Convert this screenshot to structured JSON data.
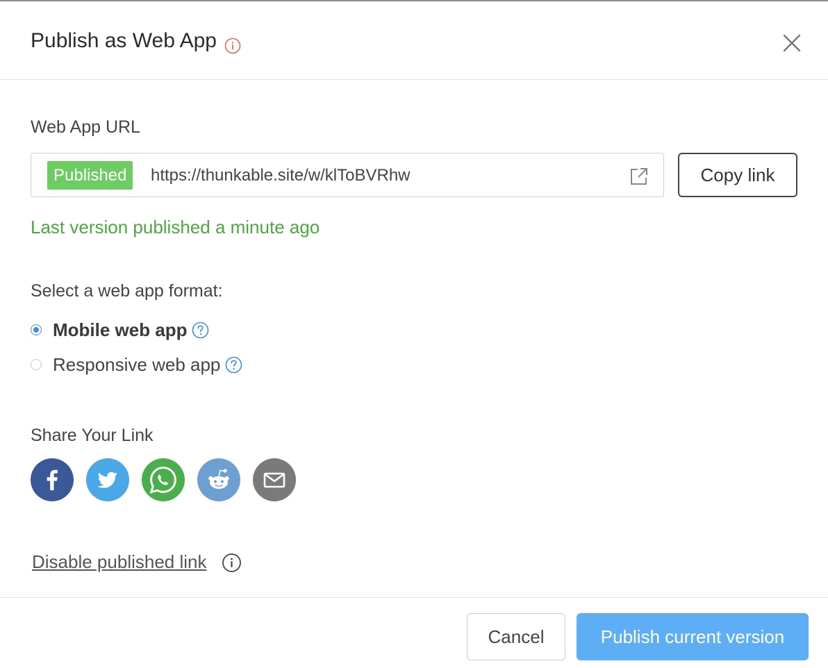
{
  "dialog": {
    "title": "Publish as Web App",
    "icons": {
      "title_info": "info-icon",
      "close": "close-icon"
    }
  },
  "url_section": {
    "label": "Web App URL",
    "badge": "Published",
    "url": "https://thunkable.site/w/klToBVRhw",
    "open_icon": "external-link-icon",
    "copy_button": "Copy link",
    "status": "Last version published a minute ago"
  },
  "format_section": {
    "label": "Select a web app format:",
    "options": [
      {
        "label": "Mobile web app",
        "selected": true
      },
      {
        "label": "Responsive web app",
        "selected": false
      }
    ],
    "help_icon": "question-circle-icon"
  },
  "share_section": {
    "label": "Share Your Link",
    "targets": [
      {
        "name": "facebook",
        "icon": "facebook-icon",
        "color": "#3b5998"
      },
      {
        "name": "twitter",
        "icon": "twitter-icon",
        "color": "#4aa8e6"
      },
      {
        "name": "whatsapp",
        "icon": "whatsapp-icon",
        "color": "#4aae4a"
      },
      {
        "name": "reddit",
        "icon": "reddit-icon",
        "color": "#6e9fd3"
      },
      {
        "name": "email",
        "icon": "email-icon",
        "color": "#7a7a7a"
      }
    ]
  },
  "disable": {
    "link": "Disable published link",
    "icon": "info-icon"
  },
  "footer": {
    "cancel": "Cancel",
    "publish": "Publish current version"
  },
  "colors": {
    "badge_green": "#6dcc62",
    "status_green": "#4ba83e",
    "accent_blue": "#3d8ce8",
    "publish_button": "#5eaef5",
    "title_info_red": "#e8635a"
  }
}
